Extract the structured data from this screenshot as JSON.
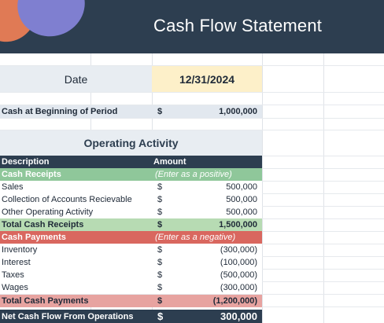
{
  "header": {
    "title": "Cash Flow Statement"
  },
  "date": {
    "label": "Date",
    "value": "12/31/2024"
  },
  "beginning": {
    "label": "Cash at Beginning of Period",
    "currency": "$",
    "amount": "1,000,000"
  },
  "operating": {
    "title": "Operating Activity",
    "col_description": "Description",
    "col_amount": "Amount",
    "receipts_header": "Cash Receipts",
    "receipts_note": "(Enter as a positive)",
    "receipts": [
      {
        "label": "Sales",
        "currency": "$",
        "amount": "500,000"
      },
      {
        "label": "Collection of Accounts Recievable",
        "currency": "$",
        "amount": "500,000"
      },
      {
        "label": "Other Operating Activity",
        "currency": "$",
        "amount": "500,000"
      }
    ],
    "total_receipts": {
      "label": "Total Cash Receipts",
      "currency": "$",
      "amount": "1,500,000"
    },
    "payments_header": "Cash Payments",
    "payments_note": "(Enter as a negative)",
    "payments": [
      {
        "label": "Inventory",
        "currency": "$",
        "amount": "(300,000)"
      },
      {
        "label": "Interest",
        "currency": "$",
        "amount": "(100,000)"
      },
      {
        "label": "Taxes",
        "currency": "$",
        "amount": "(500,000)"
      },
      {
        "label": "Wages",
        "currency": "$",
        "amount": "(300,000)"
      }
    ],
    "total_payments": {
      "label": "Total Cash Payments",
      "currency": "$",
      "amount": "(1,200,000)"
    },
    "net": {
      "label": "Net Cash Flow From Operations",
      "currency": "$",
      "amount": "300,000"
    }
  },
  "colors": {
    "header_bg": "#2d3e50",
    "green": "#8fc79a",
    "green_light": "#b7dbb3",
    "red": "#d9675f",
    "red_light": "#e7a3a0",
    "date_highlight": "#fdf0c9"
  }
}
